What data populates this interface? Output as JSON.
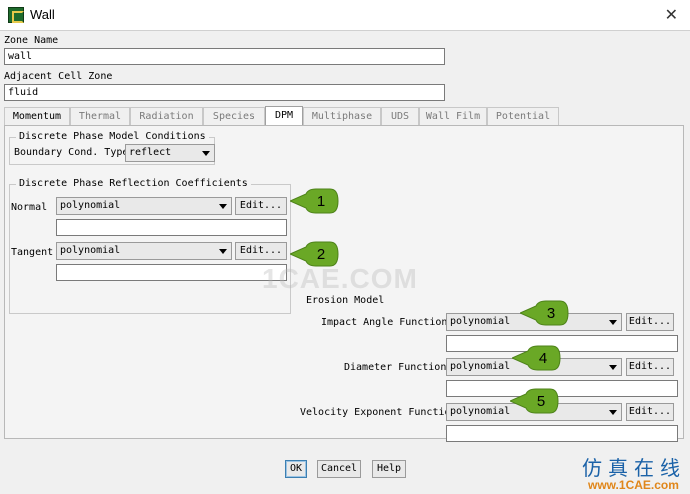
{
  "window": {
    "title": "Wall"
  },
  "zone_name": {
    "label": "Zone Name",
    "value": "wall"
  },
  "adjacent_cell_zone": {
    "label": "Adjacent Cell Zone",
    "value": "fluid"
  },
  "tabs": [
    "Momentum",
    "Thermal",
    "Radiation",
    "Species",
    "DPM",
    "Multiphase",
    "UDS",
    "Wall Film",
    "Potential"
  ],
  "active_tab": "DPM",
  "dpm_conditions": {
    "group_title": "Discrete Phase Model Conditions",
    "boundary_label": "Boundary Cond. Type",
    "boundary_value": "reflect"
  },
  "reflection": {
    "group_title": "Discrete Phase Reflection Coefficients",
    "normal_label": "Normal",
    "normal_value": "polynomial",
    "tangent_label": "Tangent",
    "tangent_value": "polynomial",
    "edit_label": "Edit..."
  },
  "erosion": {
    "group_title": "Erosion Model",
    "impact_label": "Impact Angle Function",
    "impact_value": "polynomial",
    "diameter_label": "Diameter Function",
    "diameter_value": "polynomial",
    "velocity_label": "Velocity Exponent Function",
    "velocity_value": "polynomial",
    "edit_label": "Edit..."
  },
  "callouts": [
    "1",
    "2",
    "3",
    "4",
    "5"
  ],
  "callout_color": "#6aa826",
  "buttons": {
    "ok": "OK",
    "cancel": "Cancel",
    "help": "Help"
  },
  "watermark": "1CAE.COM",
  "brand": {
    "cn": "仿真在线",
    "url": "www.1CAE.com"
  }
}
